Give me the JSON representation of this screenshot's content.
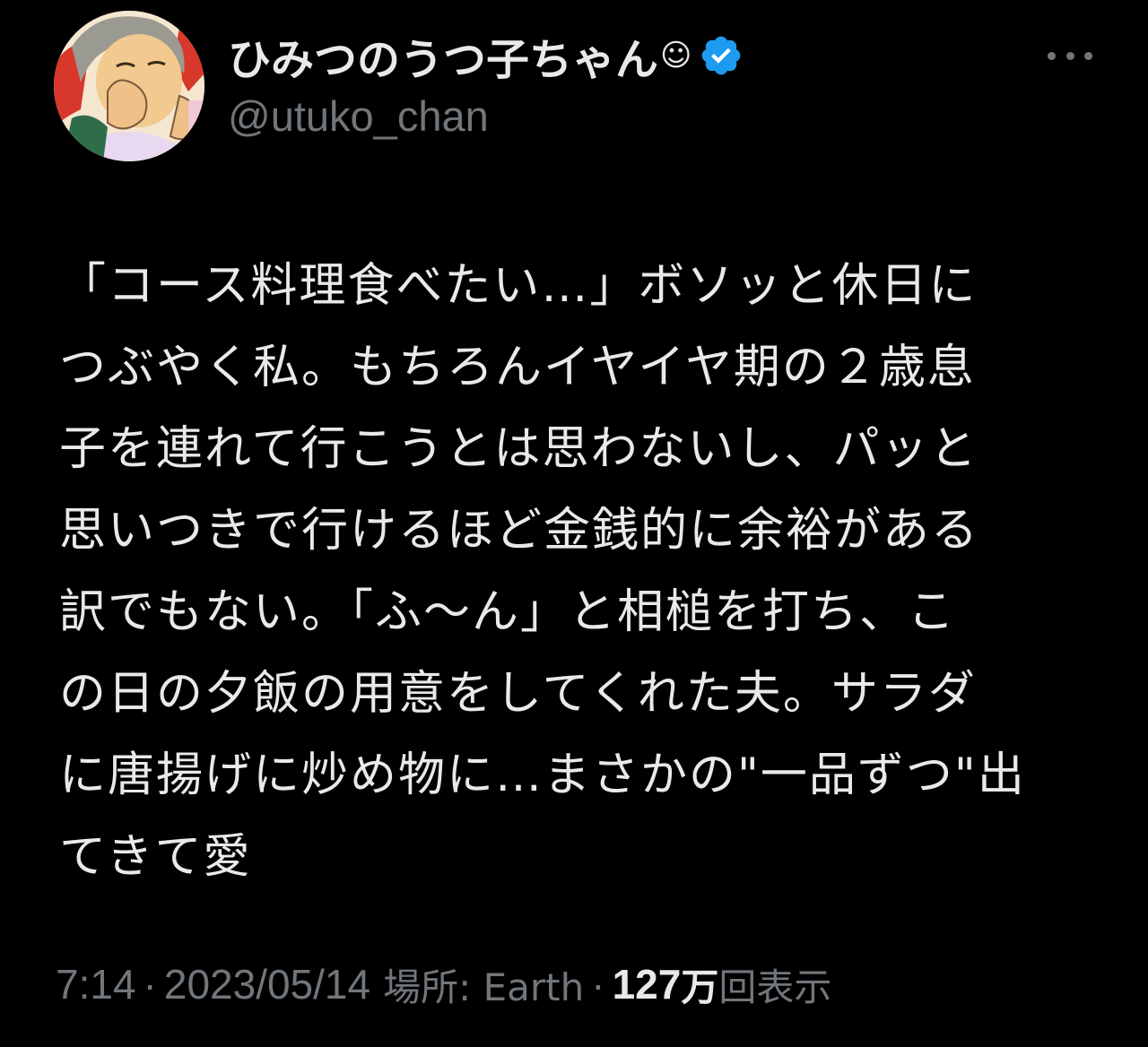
{
  "tweet": {
    "author": {
      "display_name": "ひみつのうつ子ちゃん",
      "emoji": "☺",
      "handle": "@utuko_chan",
      "verified_icon": "verified-badge-icon",
      "avatar_icon": "avatar-illustration"
    },
    "more_icon": "more-horizontal-icon",
    "text": "「コース料理食べたい…」ボソッと休日に\nつぶやく私。もちろんイヤイヤ期の２歳息\n子を連れて行こうとは思わないし、パッと\n思いつきで行けるほど金銭的に余裕がある\n訳でもない。「ふ〜ん」と相槌を打ち、こ\nの日の夕飯の用意をしてくれた夫。サラダ\nに唐揚げに炒め物に…まさかの\"一品ずつ\"出\nてきて愛",
    "meta": {
      "time": "7:14",
      "separator": "·",
      "date": "2023/05/14",
      "location_label": "場所: Earth",
      "views_count": "127",
      "views_unit": "万",
      "views_label": "回表示"
    }
  },
  "colors": {
    "background": "#000000",
    "text_primary": "#e7e9ea",
    "text_secondary": "#71767b",
    "verified_blue": "#1d9bf0"
  }
}
